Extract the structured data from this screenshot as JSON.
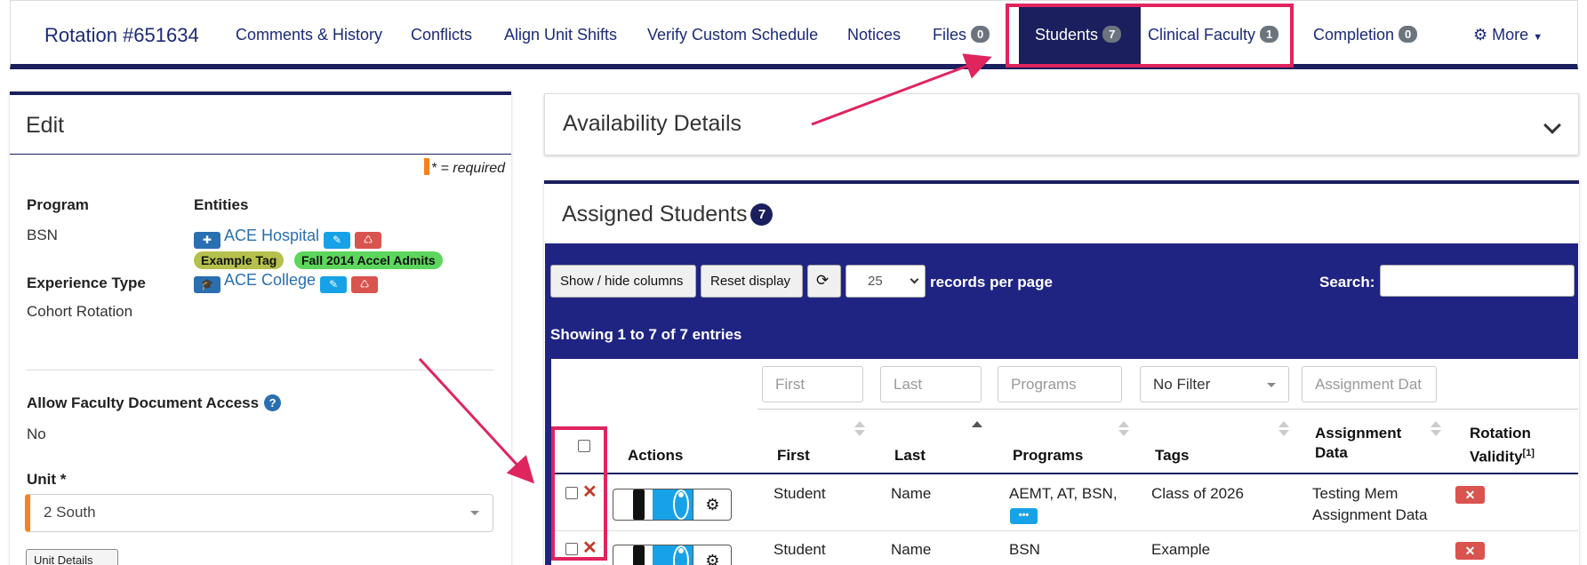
{
  "nav": {
    "title": "Rotation #651634",
    "items": [
      "Comments & History",
      "Conflicts",
      "Align Unit Shifts",
      "Verify Custom Schedule",
      "Notices"
    ],
    "files_label": "Files",
    "files_count": "0",
    "students_label": "Students",
    "students_count": "7",
    "faculty_label": "Clinical Faculty",
    "faculty_count": "1",
    "completion_label": "Completion",
    "completion_count": "0",
    "more_label": "More"
  },
  "edit": {
    "title": "Edit",
    "required_note": "* = required",
    "program_label": "Program",
    "program_value": "BSN",
    "entities_label": "Entities",
    "entity1": "ACE Hospital",
    "entity2": "ACE College",
    "tags": [
      "Example Tag",
      "Fall 2014 Accel Admits"
    ],
    "experience_label": "Experience Type",
    "experience_value": "Cohort Rotation",
    "faculty_access_label": "Allow Faculty Document Access",
    "faculty_access_value": "No",
    "unit_label": "Unit *",
    "unit_value": "2 South",
    "unit_details_button": "Unit Details"
  },
  "availability": {
    "title": "Availability Details"
  },
  "assigned": {
    "title": "Assigned Students",
    "count": "7",
    "show_hide": "Show / hide columns",
    "reset": "Reset display",
    "per_page": "25",
    "per_page_label": "records per page",
    "search_label": "Search:",
    "showing": "Showing 1 to 7 of 7 entries",
    "filters": {
      "first": "First",
      "last": "Last",
      "programs": "Programs",
      "tags": "No Filter",
      "assignment": "Assignment Dat"
    },
    "columns": {
      "actions": "Actions",
      "first": "First",
      "last": "Last",
      "programs": "Programs",
      "tags": "Tags",
      "assignment_1": "Assignment",
      "assignment_2": "Data",
      "validity_1": "Rotation",
      "validity_2": "Validity",
      "validity_sup": "[1]"
    },
    "rows": [
      {
        "first": "Student",
        "last": "Name",
        "programs": "AEMT, AT, BSN,",
        "tags": "Class of 2026",
        "assignment_1": "Testing Mem",
        "assignment_2": "Assignment Data"
      },
      {
        "first": "Student",
        "last": "Name",
        "programs": "BSN",
        "tags": "Example",
        "assignment_1": "",
        "assignment_2": ""
      }
    ]
  },
  "colors": {
    "navy": "#1b1f5e",
    "toolbar": "#1f2483",
    "highlight": "#e0245e",
    "link": "#2a6fb0",
    "required": "#f5821f"
  }
}
